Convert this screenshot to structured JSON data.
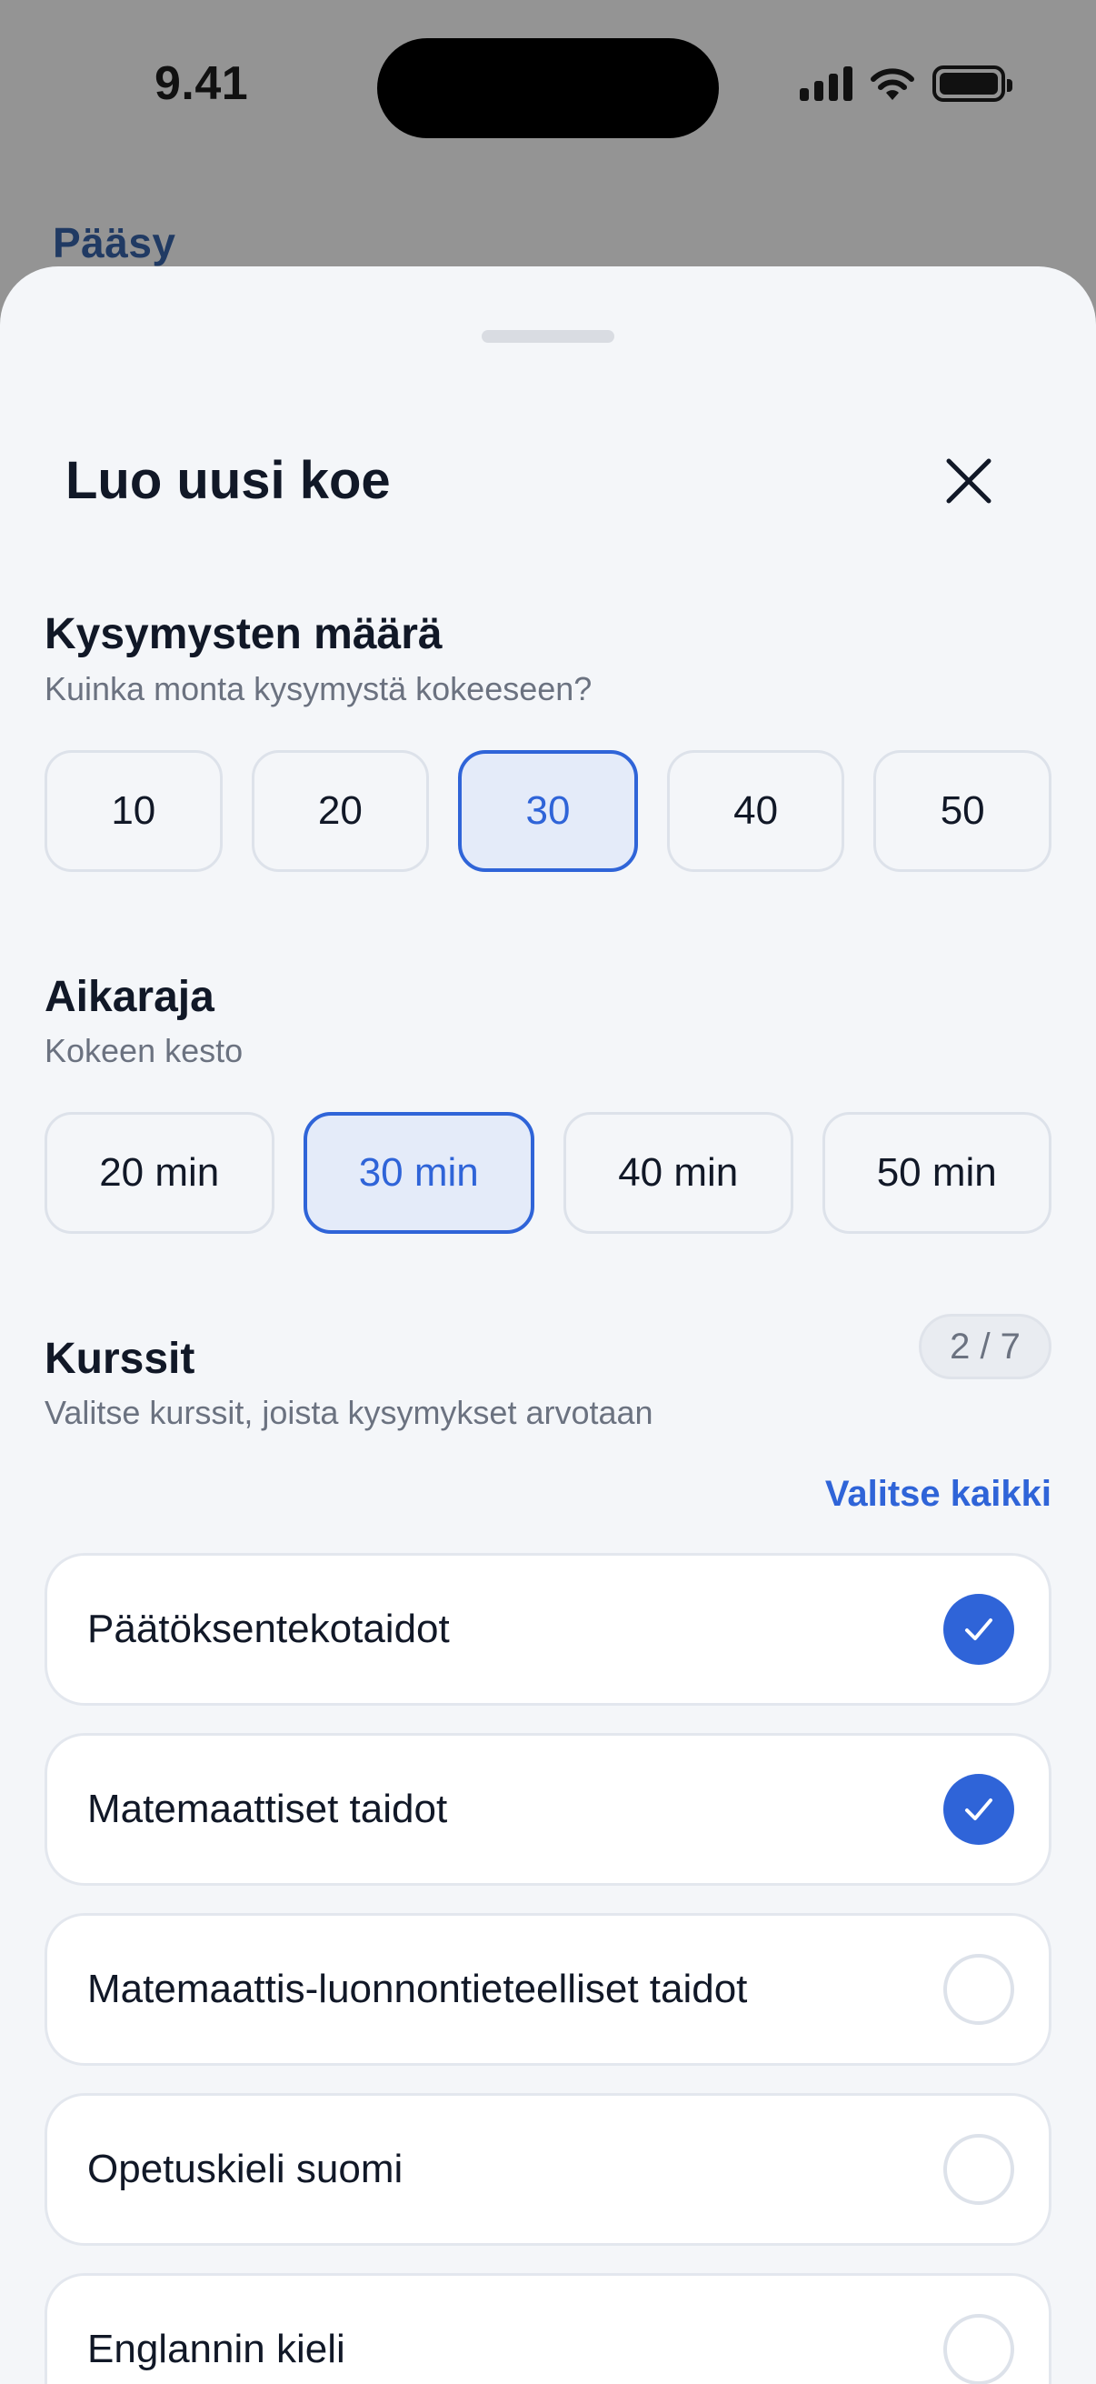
{
  "status": {
    "time": "9.41"
  },
  "brand": "Pääsy",
  "sheet": {
    "title": "Luo uusi koe",
    "question_count": {
      "title": "Kysymysten määrä",
      "subtitle": "Kuinka monta kysymystä kokeeseen?",
      "options": [
        "10",
        "20",
        "30",
        "40",
        "50"
      ],
      "selected": "30"
    },
    "time_limit": {
      "title": "Aikaraja",
      "subtitle": "Kokeen kesto",
      "options": [
        "20 min",
        "30 min",
        "40 min",
        "50 min"
      ],
      "selected": "30 min"
    },
    "courses": {
      "title": "Kurssit",
      "subtitle": "Valitse kurssit, joista kysymykset arvotaan",
      "count_badge": "2 / 7",
      "select_all_label": "Valitse kaikki",
      "items": [
        {
          "label": "Päätöksentekotaidot",
          "checked": true
        },
        {
          "label": "Matemaattiset taidot",
          "checked": true
        },
        {
          "label": "Matemaattis-luonnontieteelliset taidot",
          "checked": false
        },
        {
          "label": "Opetuskieli suomi",
          "checked": false
        },
        {
          "label": "Englannin kieli",
          "checked": false
        }
      ]
    }
  },
  "colors": {
    "accent": "#2f64d8",
    "sheet_bg": "#f4f6f9",
    "backdrop": "#949494"
  },
  "icons": {
    "close": "close-icon",
    "check": "checkmark-icon"
  }
}
